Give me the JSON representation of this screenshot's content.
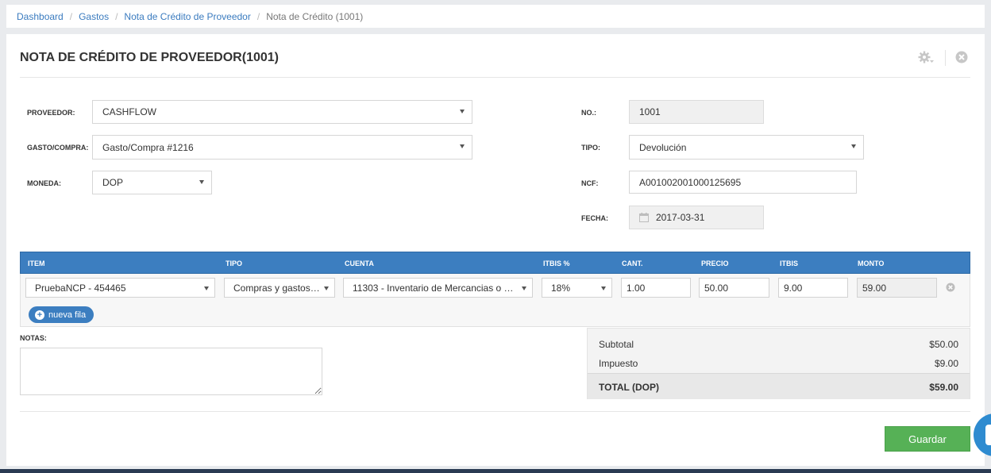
{
  "breadcrumb": {
    "items": [
      "Dashboard",
      "Gastos",
      "Nota de Crédito de Proveedor"
    ],
    "current": "Nota de Crédito (1001)"
  },
  "page": {
    "title": "NOTA DE CRÉDITO DE PROVEEDOR(1001)"
  },
  "form": {
    "proveedor_label": "PROVEEDOR:",
    "proveedor_value": "CASHFLOW",
    "gasto_label": "GASTO/COMPRA:",
    "gasto_value": "Gasto/Compra #1216",
    "moneda_label": "MONEDA:",
    "moneda_value": "DOP",
    "no_label": "NO.:",
    "no_value": "1001",
    "tipo_label": "TIPO:",
    "tipo_value": "Devolución",
    "ncf_label": "NCF:",
    "ncf_value": "A001002001000125695",
    "fecha_label": "FECHA:",
    "fecha_value": "2017-03-31"
  },
  "grid": {
    "headers": [
      "ITEM",
      "TIPO",
      "CUENTA",
      "ITBIS %",
      "CANT.",
      "PRECIO",
      "ITBIS",
      "MONTO"
    ],
    "row": {
      "item": "PruebaNCP - 454465",
      "tipo": "Compras y gastos…",
      "cuenta": "11303 - Inventario de Mercancias o …",
      "itbis_pct": "18%",
      "cant": "1.00",
      "precio": "50.00",
      "itbis": "9.00",
      "monto": "59.00"
    },
    "new_row_label": "nueva fila"
  },
  "notes": {
    "label": "NOTAS:",
    "value": ""
  },
  "totals": {
    "subtotal_label": "Subtotal",
    "subtotal_value": "$50.00",
    "impuesto_label": "Impuesto",
    "impuesto_value": "$9.00",
    "total_label": "TOTAL (DOP)",
    "total_value": "$59.00"
  },
  "actions": {
    "save_label": "Guardar"
  },
  "colors": {
    "accent": "#3c7ec0",
    "save": "#56b156",
    "link": "#3a7bbf"
  },
  "icons": [
    "gear-icon",
    "close-icon",
    "calendar-icon",
    "plus-icon",
    "remove-row-icon",
    "chat-icon"
  ]
}
